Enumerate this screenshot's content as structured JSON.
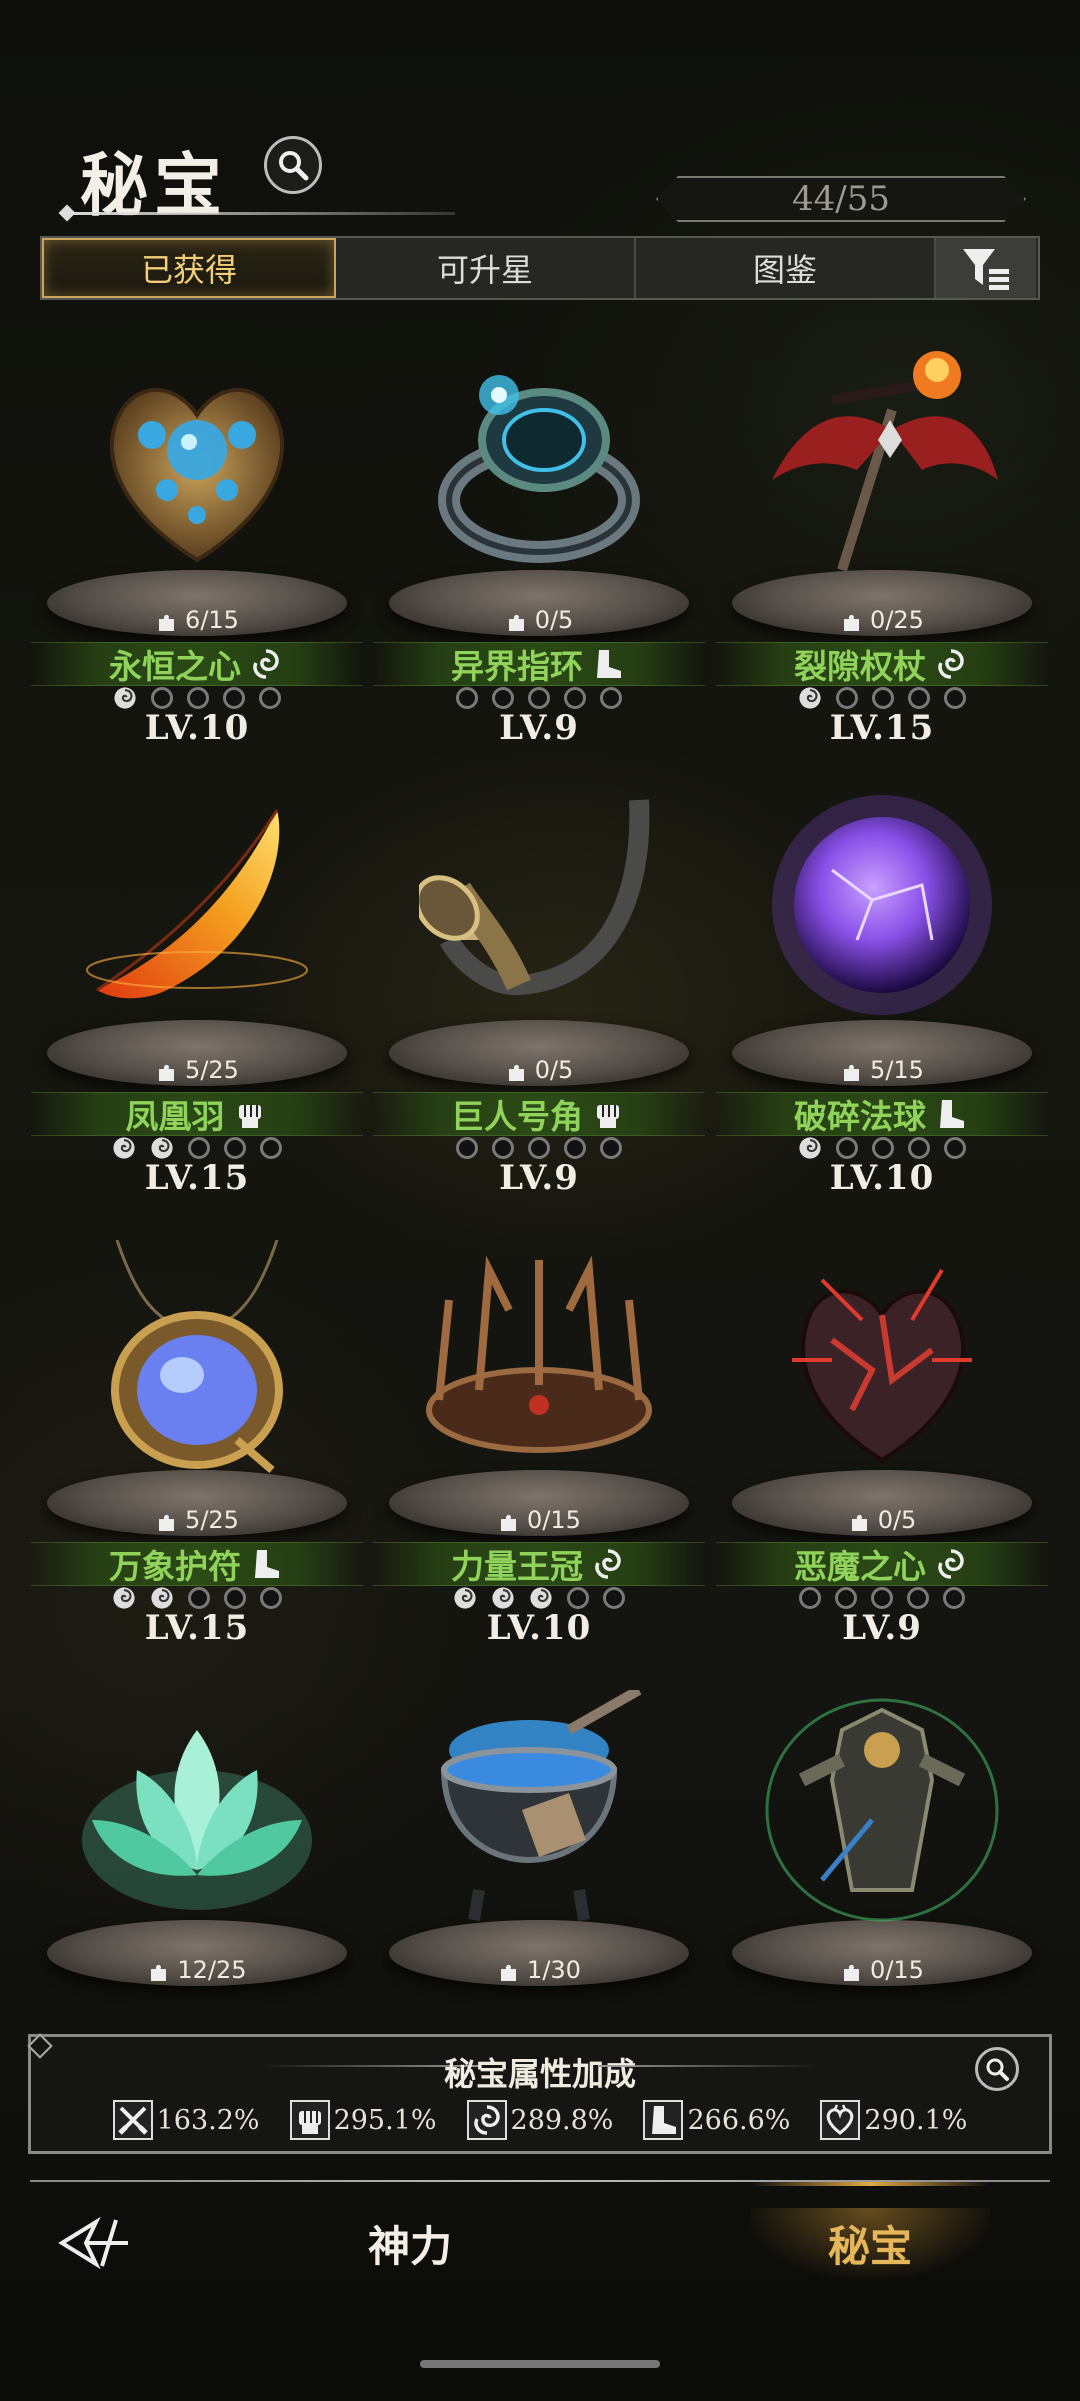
{
  "header": {
    "title": "秘宝",
    "collection_count": "44/55"
  },
  "tabs": [
    {
      "label": "已获得",
      "active": true
    },
    {
      "label": "可升星",
      "active": false
    },
    {
      "label": "图鉴",
      "active": false
    }
  ],
  "items": [
    {
      "name": "永恒之心",
      "fragments": "6/15",
      "level": "LV.10",
      "type": "swirl-icon",
      "stars": 1,
      "art": "heart-gem",
      "color": "#3aa8e0"
    },
    {
      "name": "异界指环",
      "fragments": "0/5",
      "level": "LV.9",
      "type": "boot-icon",
      "stars": 0,
      "art": "ring",
      "color": "#40c0e8"
    },
    {
      "name": "裂隙权杖",
      "fragments": "0/25",
      "level": "LV.15",
      "type": "swirl-icon",
      "stars": 1,
      "art": "scepter",
      "color": "#d84030"
    },
    {
      "name": "凤凰羽",
      "fragments": "5/25",
      "level": "LV.15",
      "type": "fist-icon",
      "stars": 2,
      "art": "feather",
      "color": "#f08a20"
    },
    {
      "name": "巨人号角",
      "fragments": "0/5",
      "level": "LV.9",
      "type": "fist-icon",
      "stars": 0,
      "art": "horn",
      "color": "#b8a070"
    },
    {
      "name": "破碎法球",
      "fragments": "5/15",
      "level": "LV.10",
      "type": "boot-icon",
      "stars": 1,
      "art": "orb",
      "color": "#8a50e8"
    },
    {
      "name": "万象护符",
      "fragments": "5/25",
      "level": "LV.15",
      "type": "boot-icon",
      "stars": 2,
      "art": "amulet",
      "color": "#6a80f0"
    },
    {
      "name": "力量王冠",
      "fragments": "0/15",
      "level": "LV.10",
      "type": "swirl-icon",
      "stars": 3,
      "art": "crown",
      "color": "#a06a40"
    },
    {
      "name": "恶魔之心",
      "fragments": "0/5",
      "level": "LV.9",
      "type": "swirl-icon",
      "stars": 0,
      "art": "demon-heart",
      "color": "#c83a30"
    },
    {
      "name": "",
      "fragments": "12/25",
      "level": "",
      "type": "",
      "stars": 0,
      "art": "lotus",
      "color": "#60e0b8"
    },
    {
      "name": "",
      "fragments": "1/30",
      "level": "",
      "type": "",
      "stars": 0,
      "art": "cauldron",
      "color": "#3aa0f0"
    },
    {
      "name": "",
      "fragments": "0/15",
      "level": "",
      "type": "",
      "stars": 0,
      "art": "armor",
      "color": "#40b060"
    }
  ],
  "bonus": {
    "title": "秘宝属性加成",
    "stats": [
      {
        "icon": "sword-icon",
        "value": "163.2%"
      },
      {
        "icon": "fist-icon",
        "value": "295.1%"
      },
      {
        "icon": "swirl-icon",
        "value": "289.8%"
      },
      {
        "icon": "boot-icon",
        "value": "266.6%"
      },
      {
        "icon": "heart-icon",
        "value": "290.1%"
      }
    ]
  },
  "nav": {
    "tabs": [
      {
        "label": "神力",
        "active": false
      },
      {
        "label": "秘宝",
        "active": true
      }
    ]
  }
}
